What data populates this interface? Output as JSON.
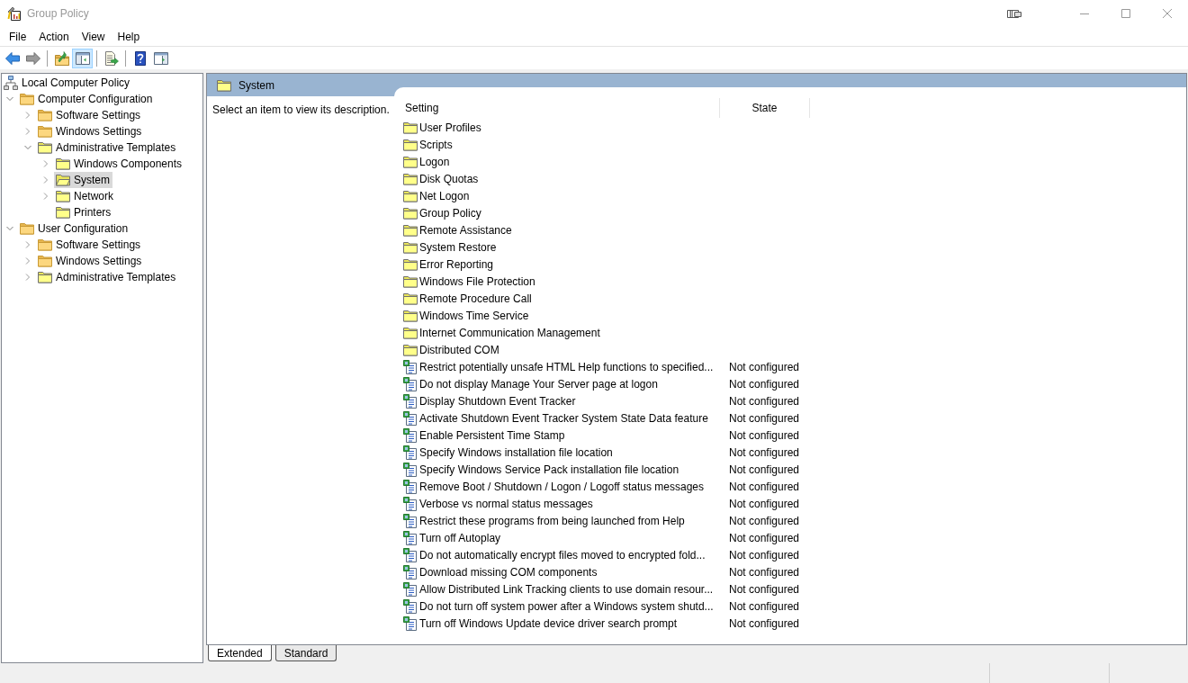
{
  "window": {
    "title": "Group Policy"
  },
  "menu": [
    "File",
    "Action",
    "View",
    "Help"
  ],
  "toolbar": [
    [
      {
        "disabled": false,
        "pressed": false
      },
      {
        "disabled": true,
        "pressed": false
      }
    ],
    [
      {
        "disabled": false,
        "pressed": false
      },
      {
        "disabled": false,
        "pressed": true
      }
    ],
    [
      {
        "disabled": false,
        "pressed": false
      }
    ],
    [
      {
        "disabled": false,
        "pressed": false
      },
      {
        "disabled": false,
        "pressed": false
      }
    ]
  ],
  "tree": [
    {
      "label": "Local Computer Policy",
      "kind": "policy",
      "expandable": false,
      "selected": false,
      "children": [
        {
          "label": "Computer Configuration",
          "kind": "folder",
          "expandable": true,
          "expanded": true,
          "selected": false,
          "children": [
            {
              "label": "Software Settings",
              "kind": "folder",
              "expandable": true,
              "expanded": false,
              "selected": false
            },
            {
              "label": "Windows Settings",
              "kind": "folder",
              "expandable": true,
              "expanded": false,
              "selected": false
            },
            {
              "label": "Administrative Templates",
              "kind": "template_folder",
              "expandable": true,
              "expanded": true,
              "selected": false,
              "children": [
                {
                  "label": "Windows Components",
                  "kind": "template_folder",
                  "expandable": true,
                  "expanded": false,
                  "selected": false
                },
                {
                  "label": "System",
                  "kind": "template_folder",
                  "expandable": true,
                  "expanded": false,
                  "selected": true
                },
                {
                  "label": "Network",
                  "kind": "template_folder",
                  "expandable": true,
                  "expanded": false,
                  "selected": false
                },
                {
                  "label": "Printers",
                  "kind": "template_folder",
                  "expandable": false,
                  "selected": false
                }
              ]
            }
          ]
        },
        {
          "label": "User Configuration",
          "kind": "folder",
          "expandable": true,
          "expanded": true,
          "selected": false,
          "children": [
            {
              "label": "Software Settings",
              "kind": "folder",
              "expandable": true,
              "expanded": false,
              "selected": false
            },
            {
              "label": "Windows Settings",
              "kind": "folder",
              "expandable": true,
              "expanded": false,
              "selected": false
            },
            {
              "label": "Administrative Templates",
              "kind": "template_folder",
              "expandable": true,
              "expanded": false,
              "selected": false
            }
          ]
        }
      ]
    }
  ],
  "details": {
    "title": "System",
    "description": "Select an item to view its description.",
    "columns": [
      "Setting",
      "State"
    ],
    "rows": [
      {
        "kind": "folder",
        "name": "User Profiles"
      },
      {
        "kind": "folder",
        "name": "Scripts"
      },
      {
        "kind": "folder",
        "name": "Logon"
      },
      {
        "kind": "folder",
        "name": "Disk Quotas"
      },
      {
        "kind": "folder",
        "name": "Net Logon"
      },
      {
        "kind": "folder",
        "name": "Group Policy"
      },
      {
        "kind": "folder",
        "name": "Remote Assistance"
      },
      {
        "kind": "folder",
        "name": "System Restore"
      },
      {
        "kind": "folder",
        "name": "Error Reporting"
      },
      {
        "kind": "folder",
        "name": "Windows File Protection"
      },
      {
        "kind": "folder",
        "name": "Remote Procedure Call"
      },
      {
        "kind": "folder",
        "name": "Windows Time Service"
      },
      {
        "kind": "folder",
        "name": "Internet Communication Management"
      },
      {
        "kind": "folder",
        "name": "Distributed COM"
      },
      {
        "kind": "setting",
        "name": "Restrict potentially unsafe HTML Help functions to specified...",
        "state": "Not configured"
      },
      {
        "kind": "setting",
        "name": "Do not display Manage Your Server page at logon",
        "state": "Not configured"
      },
      {
        "kind": "setting",
        "name": "Display Shutdown Event Tracker",
        "state": "Not configured"
      },
      {
        "kind": "setting",
        "name": "Activate Shutdown Event Tracker System State Data feature",
        "state": "Not configured"
      },
      {
        "kind": "setting",
        "name": "Enable Persistent Time Stamp",
        "state": "Not configured"
      },
      {
        "kind": "setting",
        "name": "Specify Windows installation file location",
        "state": "Not configured"
      },
      {
        "kind": "setting",
        "name": "Specify Windows Service Pack installation file location",
        "state": "Not configured"
      },
      {
        "kind": "setting",
        "name": "Remove Boot / Shutdown / Logon / Logoff status messages",
        "state": "Not configured"
      },
      {
        "kind": "setting",
        "name": "Verbose vs normal status messages",
        "state": "Not configured"
      },
      {
        "kind": "setting",
        "name": "Restrict these programs from being launched from Help",
        "state": "Not configured"
      },
      {
        "kind": "setting",
        "name": "Turn off Autoplay",
        "state": "Not configured"
      },
      {
        "kind": "setting",
        "name": "Do not automatically encrypt files moved to encrypted fold...",
        "state": "Not configured"
      },
      {
        "kind": "setting",
        "name": "Download missing COM components",
        "state": "Not configured"
      },
      {
        "kind": "setting",
        "name": "Allow Distributed Link Tracking clients to use domain resour...",
        "state": "Not configured"
      },
      {
        "kind": "setting",
        "name": "Do not turn off system power after a Windows system shutd...",
        "state": "Not configured"
      },
      {
        "kind": "setting",
        "name": "Turn off Windows Update device driver search prompt",
        "state": "Not configured"
      }
    ]
  },
  "tabs": [
    {
      "label": "Extended",
      "selected": true
    },
    {
      "label": "Standard",
      "selected": false
    }
  ]
}
